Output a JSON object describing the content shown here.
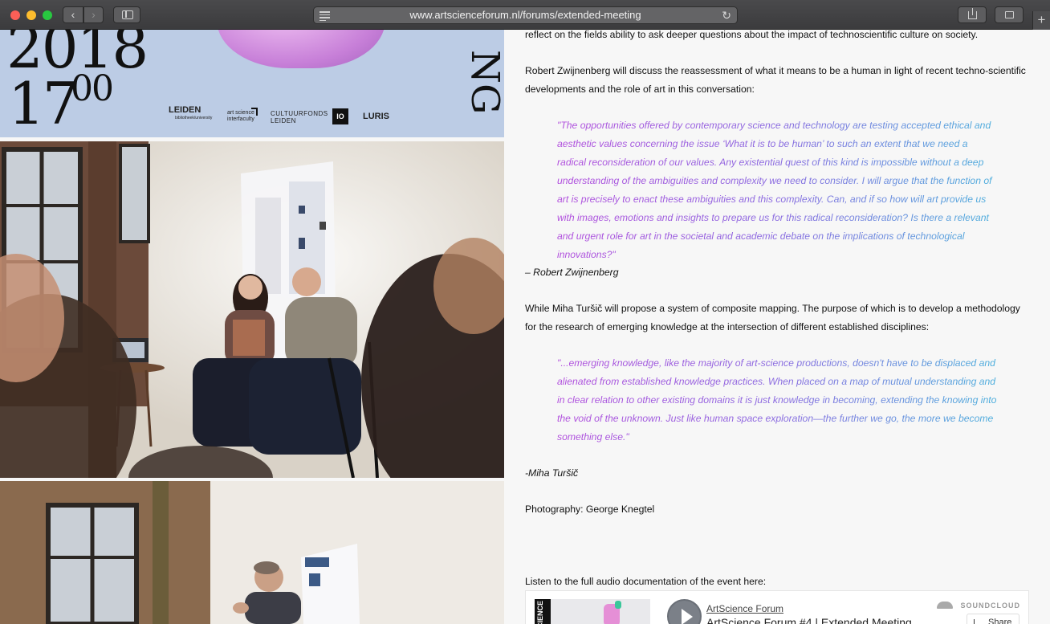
{
  "browser": {
    "url": "www.artscienceforum.nl/forums/extended-meeting",
    "back_glyph": "‹",
    "forward_glyph": "›",
    "reload_glyph": "↻",
    "new_tab_glyph": "+"
  },
  "poster": {
    "year": "2018",
    "time_hour": "17",
    "time_minutes": "00",
    "vertical_letters": "NG",
    "logos": {
      "leiden": "LEIDEN",
      "leiden_sub": "bibliotheek/university",
      "artscience": "art science",
      "artscience_sub": "interfaculty",
      "cultuurfonds": "CULTUURFONDS",
      "cultuurfonds_sub": "LEIDEN",
      "io": "IO",
      "luris": "LURIS"
    }
  },
  "article": {
    "intro_end": "reflect on the fields ability to ask deeper questions about the impact of technoscientific culture on society.",
    "zwijnenberg_intro": "Robert Zwijnenberg will discuss the reassessment of what it means to be a human in light of recent techno-scientific developments and the role of art in this conversation:",
    "zwijnenberg_quote": "\"The opportunities offered by contemporary science and technology are testing accepted ethical and aesthetic values concerning the issue ‘What it is to be human’ to such an extent that we need a radical reconsideration of our values. Any existential quest of this kind is impossible without a deep understanding of the ambiguities and complexity we need to consider. I will argue that the function of art is precisely to enact these ambiguities and this complexity. Can, and if so how will art provide us with images, emotions and insights to prepare us for this radical reconsideration? Is there a relevant and urgent role for art in the societal and academic debate on the implications of technological innovations?\"",
    "zwijnenberg_attribution": "– Robert Zwijnenberg",
    "tursic_intro": "While Miha Turšič will propose a system of composite mapping. The purpose of which is to develop a methodology for the research of emerging knowledge at the intersection of different established disciplines:",
    "tursic_quote": "\"...emerging knowledge, like the majority of art-science productions, doesn't have to be displaced and alienated from established knowledge practices. When placed on a map of mutual understanding and in clear relation to other existing domains it is just knowledge in becoming, extending the knowing into the void of the unknown. Just like human space exploration—the further we go, the more we become something else.\"",
    "tursic_attribution": "-Miha Turšič",
    "photography_credit": "Photography: George Knegtel",
    "audio_intro": "Listen to the full audio documentation of the event here:"
  },
  "soundcloud": {
    "artwork_text": "SCIENCE",
    "user": "ArtScience Forum",
    "track": "ArtScience Forum #4 | Extended Meeting",
    "brand": "SOUNDCLOUD",
    "share_label": "Share"
  },
  "colors": {
    "quote_gradient": [
      "#b14ddd",
      "#8a6ae0",
      "#4aaedc"
    ],
    "poster_background": "#bccce5"
  }
}
